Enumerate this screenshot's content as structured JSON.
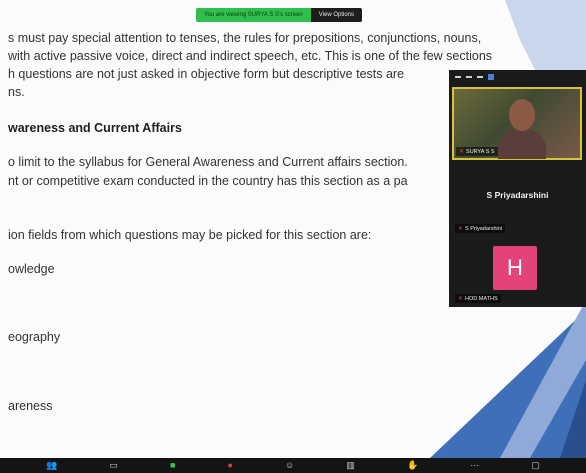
{
  "share_banner": {
    "message": "You are viewing SURYA S S's screen",
    "options_label": "View Options"
  },
  "document": {
    "lines": [
      "s must pay special attention to tenses, the rules for prepositions, conjunctions, nouns,",
      "with active passive voice, direct and indirect speech, etc. This is one of the few sections",
      "h questions are not just asked in objective form but descriptive tests are",
      "ns.",
      "wareness and Current Affairs",
      "o limit to the syllabus for General Awareness and Current affairs section.",
      "nt or competitive exam conducted in the country has this section as a pa",
      "ion fields from which questions may be picked for this section are:",
      "owledge",
      "eography",
      "areness"
    ]
  },
  "participants": {
    "video_tile_label": "SURYA S S",
    "name": "S Priyadarshini",
    "name_small": "S Priyadarshini",
    "avatar_letter": "H",
    "bottom_label": "HOD MATHS",
    "avatar_color": "#e3437a"
  },
  "toolbar": {
    "icons": [
      "participants-icon",
      "chat-icon",
      "share-screen-icon",
      "record-icon",
      "reactions-icon",
      "apps-icon",
      "leave-icon"
    ]
  },
  "colors": {
    "banner_green": "#2fbf4e",
    "panel_bg": "#1b1b1b",
    "active_speaker_border": "#d9c23c",
    "deco_blue": "#3f6fb8"
  }
}
